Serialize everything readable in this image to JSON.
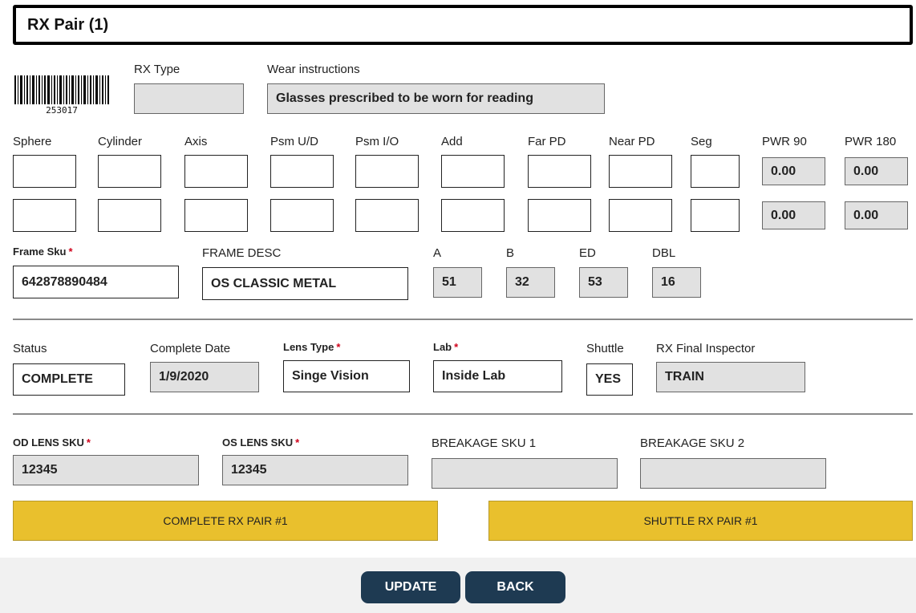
{
  "header": {
    "title": "RX Pair (1)"
  },
  "barcode": {
    "number": "253017"
  },
  "top": {
    "rx_type_label": "RX Type",
    "rx_type_value": "",
    "wear_label": "Wear instructions",
    "wear_value": "Glasses prescribed to be worn for reading"
  },
  "rx_columns": [
    "Sphere",
    "Cylinder",
    "Axis",
    "Psm U/D",
    "Psm I/O",
    "Add",
    "Far PD",
    "Near PD",
    "Seg",
    "PWR 90",
    "PWR 180"
  ],
  "rx_rows": [
    [
      "",
      "",
      "",
      "",
      "",
      "",
      "",
      "",
      "",
      "0.00",
      "0.00"
    ],
    [
      "",
      "",
      "",
      "",
      "",
      "",
      "",
      "",
      "",
      "0.00",
      "0.00"
    ]
  ],
  "frame": {
    "sku_label": "Frame Sku",
    "sku_value": "642878890484",
    "desc_label": "FRAME DESC",
    "desc_value": "OS CLASSIC METAL",
    "a_label": "A",
    "a_value": "51",
    "b_label": "B",
    "b_value": "32",
    "ed_label": "ED",
    "ed_value": "53",
    "dbl_label": "DBL",
    "dbl_value": "16"
  },
  "status": {
    "status_label": "Status",
    "status_value": "COMPLETE",
    "date_label": "Complete Date",
    "date_value": "1/9/2020",
    "lens_label": "Lens Type",
    "lens_value": "Singe Vision",
    "lab_label": "Lab",
    "lab_value": "Inside Lab",
    "shuttle_label": "Shuttle",
    "shuttle_value": "YES",
    "inspector_label": "RX Final Inspector",
    "inspector_value": "TRAIN"
  },
  "lens": {
    "od_label": "OD LENS SKU",
    "od_value": "12345",
    "os_label": "OS LENS SKU",
    "os_value": "12345",
    "b1_label": "BREAKAGE SKU 1",
    "b1_value": "",
    "b2_label": "BREAKAGE SKU 2",
    "b2_value": ""
  },
  "actions": {
    "complete_label": "COMPLETE RX PAIR #1",
    "shuttle_label": "SHUTTLE RX PAIR #1"
  },
  "footer": {
    "update_label": "UPDATE",
    "back_label": "BACK"
  },
  "colors": {
    "action_yellow": "#e9c02d",
    "nav_button": "#1e3a52",
    "required": "#d0021b",
    "readonly_gray": "#e1e1e1"
  }
}
